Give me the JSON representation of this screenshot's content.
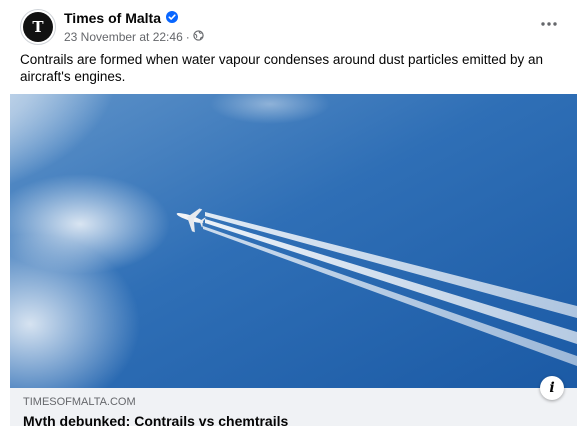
{
  "post": {
    "page_name": "Times of Malta",
    "avatar_letter": "T",
    "timestamp": "23 November at 22:46",
    "separator": "·",
    "audience_icon": "globe-icon",
    "verified_icon": "verified-badge-icon",
    "more_icon": "more-options-icon",
    "caption": "Contrails are formed when water vapour condenses around dust particles emitted by an aircraft's engines."
  },
  "link_preview": {
    "domain": "TIMESOFMALTA.COM",
    "title": "Myth debunked: Contrails vs chemtrails",
    "info_label": "i",
    "info_icon": "info-icon"
  },
  "colors": {
    "brand_blue": "#0866ff",
    "text_primary": "#050505",
    "text_secondary": "#65676b",
    "link_bar_bg": "#f0f2f5",
    "sky": "#2f6fb6"
  }
}
